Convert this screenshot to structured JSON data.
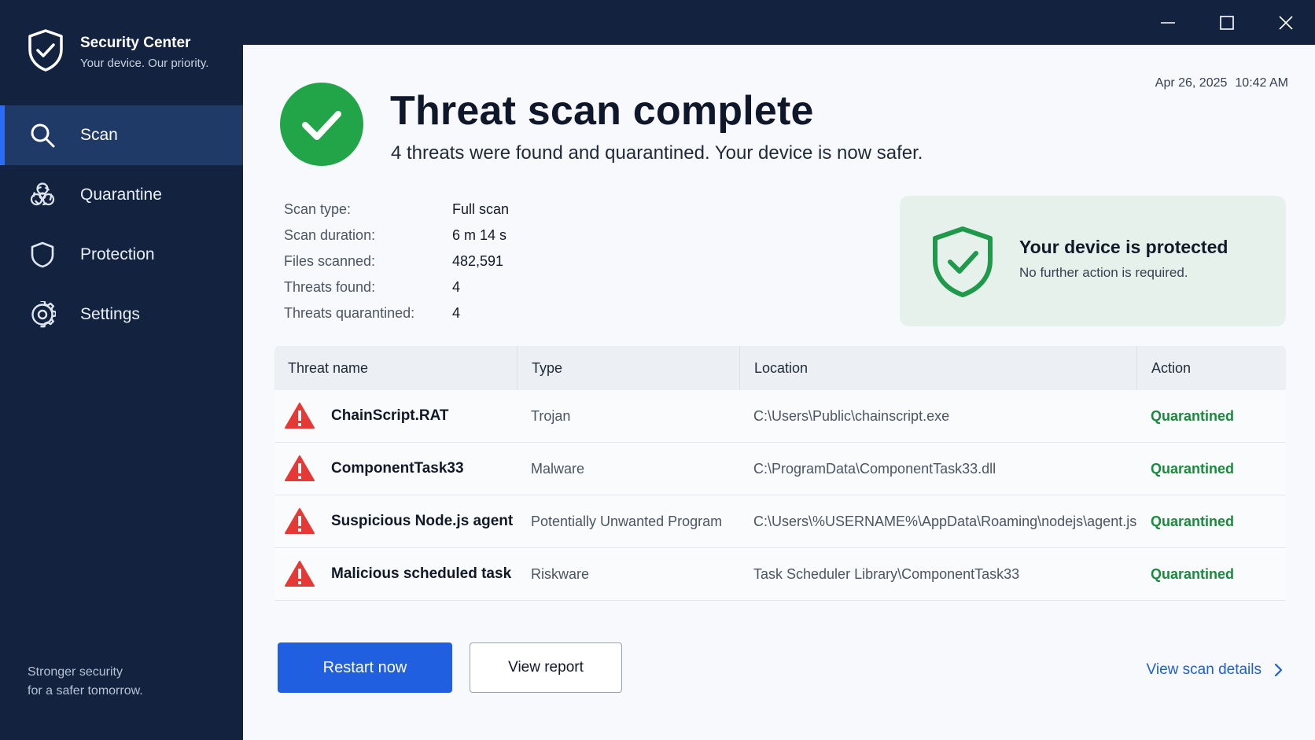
{
  "app": {
    "title": "Security Center",
    "tagline": "Your device. Our priority."
  },
  "nav": {
    "items": [
      {
        "label": "Scan",
        "icon": "search-icon",
        "active": true
      },
      {
        "label": "Quarantine",
        "icon": "biohazard-icon",
        "active": false
      },
      {
        "label": "Protection",
        "icon": "shield-icon",
        "active": false
      },
      {
        "label": "Settings",
        "icon": "gear-icon",
        "active": false
      }
    ]
  },
  "sidebar_footer": {
    "line1": "Stronger security",
    "line2": "for a safer tomorrow."
  },
  "window_controls": [
    "minimize-icon",
    "maximize-icon",
    "close-icon"
  ],
  "header": {
    "date": "Apr 26, 2025",
    "time": "10:42 AM",
    "title": "Threat scan complete",
    "subtitle": "4 threats were found and quarantined. Your device is now safer."
  },
  "scan_details": [
    {
      "label": "Scan type:",
      "value": "Full scan"
    },
    {
      "label": "Scan duration:",
      "value": "6 m 14 s"
    },
    {
      "label": "Files scanned:",
      "value": "482,591"
    },
    {
      "label": "Threats found:",
      "value": "4"
    },
    {
      "label": "Threats quarantined:",
      "value": "4"
    }
  ],
  "protection_card": {
    "title": "Your device is protected",
    "subtitle": "No further action is required."
  },
  "table": {
    "headers": [
      "Threat name",
      "Type",
      "Location",
      "Action"
    ],
    "rows": [
      {
        "name": "ChainScript.RAT",
        "type": "Trojan",
        "location": "C:\\Users\\Public\\chainscript.exe",
        "action": "Quarantined"
      },
      {
        "name": "ComponentTask33",
        "type": "Malware",
        "location": "C:\\ProgramData\\ComponentTask33.dll",
        "action": "Quarantined"
      },
      {
        "name": "Suspicious Node.js agent",
        "type": "Potentially Unwanted Program",
        "location": "C:\\Users\\%USERNAME%\\AppData\\Roaming\\nodejs\\agent.js",
        "action": "Quarantined"
      },
      {
        "name": "Malicious scheduled task",
        "type": "Riskware",
        "location": "Task Scheduler Library\\ComponentTask33",
        "action": "Quarantined"
      }
    ]
  },
  "actions": {
    "restart": "Restart now",
    "view_report": "View report",
    "view_details": "View scan details"
  },
  "colors": {
    "sidebar": "#13233f",
    "accent": "#1f5fe0",
    "success": "#22a548",
    "warning": "#e53935"
  }
}
